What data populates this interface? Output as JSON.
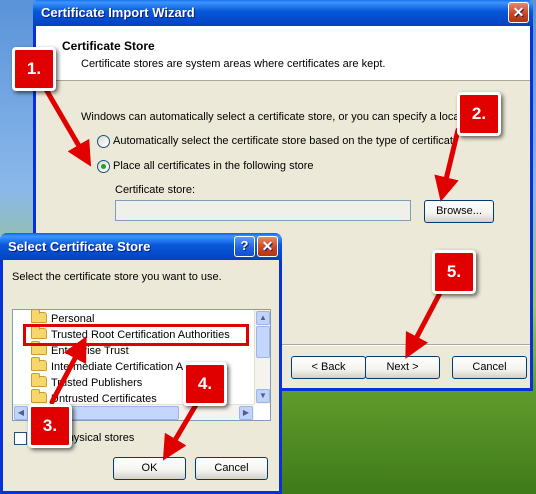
{
  "wizard": {
    "title": "Certificate Import Wizard",
    "close_glyph": "✕",
    "header_title": "Certificate Store",
    "header_desc": "Certificate stores are system areas where certificates are kept.",
    "body_text": "Windows can automatically select a certificate store, or you can specify a loca",
    "option_auto": "Automatically select the certificate store based on the type of certificat",
    "option_place": "Place all certificates in the following store",
    "store_label": "Certificate store:",
    "store_value": "",
    "browse": "Browse...",
    "back": "< Back",
    "next": "Next >",
    "cancel": "Cancel"
  },
  "dialog": {
    "title": "Select Certificate Store",
    "help_glyph": "?",
    "close_glyph": "✕",
    "prompt": "Select the certificate store you want to use.",
    "stores": [
      "Personal",
      "Trusted Root Certification Authorities",
      "Enterprise Trust",
      "Intermediate Certification Authorities",
      "Trusted Publishers",
      "Untrusted Certificates"
    ],
    "selected_store": "Trusted Root Certification Authorities",
    "show_physical": "Show physical stores",
    "ok": "OK",
    "cancel": "Cancel"
  },
  "callouts": [
    "1.",
    "2.",
    "3.",
    "4.",
    "5."
  ],
  "colors": {
    "callout": "#e00000",
    "highlight_box": "#e00000",
    "xp_blue": "#0831d9"
  }
}
